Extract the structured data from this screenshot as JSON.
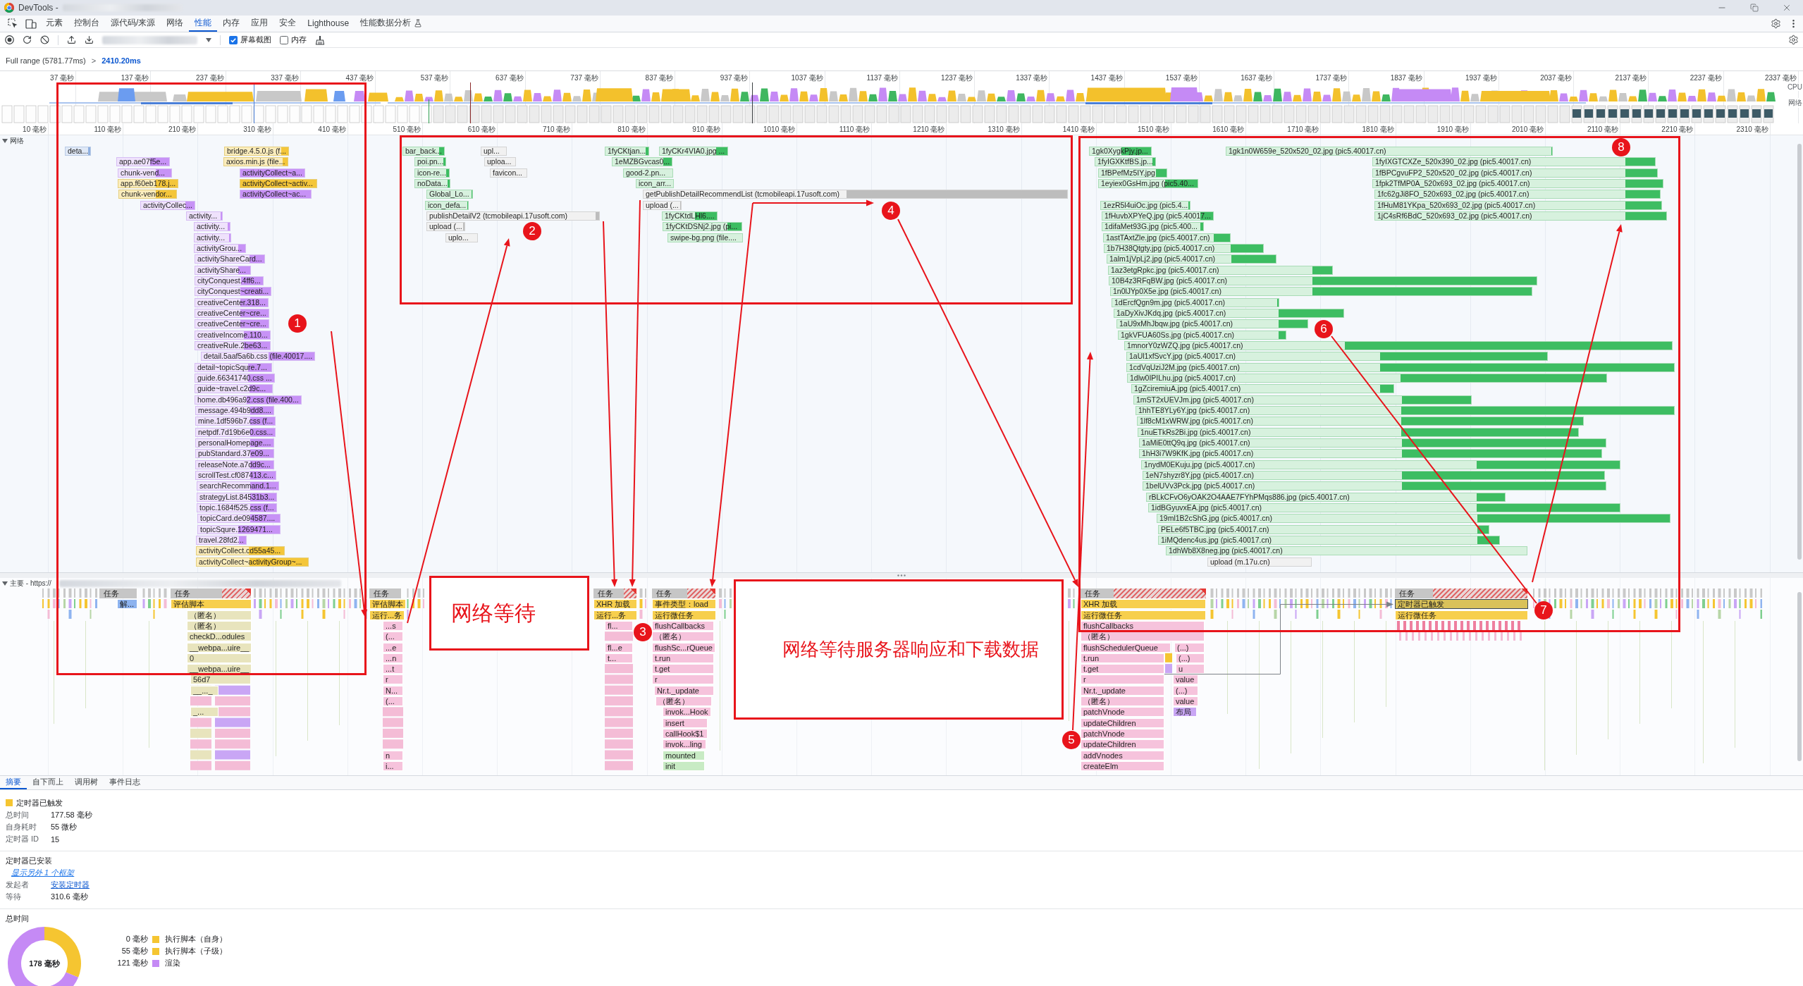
{
  "window": {
    "title": "DevTools -"
  },
  "tabs": [
    {
      "label": "元素",
      "selected": false
    },
    {
      "label": "控制台",
      "selected": false
    },
    {
      "label": "源代码/来源",
      "selected": false
    },
    {
      "label": "网络",
      "selected": false
    },
    {
      "label": "性能",
      "selected": true
    },
    {
      "label": "内存",
      "selected": false
    },
    {
      "label": "应用",
      "selected": false
    },
    {
      "label": "安全",
      "selected": false
    },
    {
      "label": "Lighthouse",
      "selected": false
    },
    {
      "label": "性能数据分析",
      "selected": false
    }
  ],
  "toolbar": {
    "options": [
      {
        "label": "屏幕截图",
        "checked": true
      },
      {
        "label": "内存",
        "checked": false
      }
    ]
  },
  "breadcrumb": {
    "full_range": "Full range (5781.77ms)",
    "separator": ">",
    "current": "2410.20ms"
  },
  "overview": {
    "ticks": [
      "37 毫秒",
      "137 毫秒",
      "237 毫秒",
      "337 毫秒",
      "437 毫秒",
      "537 毫秒",
      "637 毫秒",
      "737 毫秒",
      "837 毫秒",
      "937 毫秒",
      "1037 毫秒",
      "1137 毫秒",
      "1237 毫秒",
      "1337 毫秒",
      "1437 毫秒",
      "1537 毫秒",
      "1637 毫秒",
      "1737 毫秒",
      "1837 毫秒",
      "1937 毫秒",
      "2037 毫秒",
      "2137 毫秒",
      "2237 毫秒",
      "2337 毫秒"
    ],
    "track_labels": [
      "CPU",
      "网络"
    ]
  },
  "ruler": {
    "ticks": [
      "10 毫秒",
      "110 毫秒",
      "210 毫秒",
      "310 毫秒",
      "410 毫秒",
      "510 毫秒",
      "610 毫秒",
      "710 毫秒",
      "810 毫秒",
      "910 毫秒",
      "1010 毫秒",
      "1110 毫秒",
      "1210 毫秒",
      "1310 毫秒",
      "1410 毫秒",
      "1510 毫秒",
      "1610 毫秒",
      "1710 毫秒",
      "1810 毫秒",
      "1910 毫秒",
      "2010 毫秒",
      "2110 毫秒",
      "2210 毫秒",
      "2310 毫秒"
    ]
  },
  "network": {
    "title": "网络",
    "expanded": true,
    "requests": [
      {
        "label": "deta...",
        "kind": "document"
      },
      {
        "label": "bridge.4.5.0.js (f...",
        "kind": "script"
      },
      {
        "label": "app.ae07f5e...",
        "kind": "stylesheet"
      },
      {
        "label": "axios.min.js (file...",
        "kind": "script"
      },
      {
        "label": "chunk-vend...",
        "kind": "stylesheet"
      },
      {
        "label": "activityCollect~a...",
        "kind": "stylesheet"
      },
      {
        "label": "app.f60eb178.j...",
        "kind": "script"
      },
      {
        "label": "activityCollect~activ...",
        "kind": "script"
      },
      {
        "label": "chunk-vendor...",
        "kind": "script"
      },
      {
        "label": "activityCollect~ac...",
        "kind": "stylesheet"
      },
      {
        "label": "activityCollec...",
        "kind": "stylesheet"
      },
      {
        "label": "activity...",
        "kind": "stylesheet"
      },
      {
        "label": "activity...",
        "kind": "stylesheet"
      },
      {
        "label": "activity...",
        "kind": "stylesheet"
      },
      {
        "label": "activityGrou...",
        "kind": "stylesheet"
      },
      {
        "label": "activityShareCard...",
        "kind": "stylesheet"
      },
      {
        "label": "activityShare...",
        "kind": "stylesheet"
      },
      {
        "label": "cityConquest.4ff6...",
        "kind": "stylesheet"
      },
      {
        "label": "cityConquest~creati...",
        "kind": "stylesheet"
      },
      {
        "label": "creativeCenter.318...",
        "kind": "stylesheet"
      },
      {
        "label": "creativeCenter~cre...",
        "kind": "stylesheet"
      },
      {
        "label": "creativeCenter~cre...",
        "kind": "stylesheet"
      },
      {
        "label": "creativeIncome.110...",
        "kind": "stylesheet"
      },
      {
        "label": "creativeRule.2be63...",
        "kind": "stylesheet"
      },
      {
        "label": "detail.5aaf5a6b.css (file.40017....",
        "kind": "stylesheet"
      },
      {
        "label": "detail~topicSqure.7...",
        "kind": "stylesheet"
      },
      {
        "label": "guide.66341740.css ...",
        "kind": "stylesheet"
      },
      {
        "label": "guide~travel.c2d9c...",
        "kind": "stylesheet"
      },
      {
        "label": "home.db496a92.css (file.400...",
        "kind": "stylesheet"
      },
      {
        "label": "message.494b9dd8....",
        "kind": "stylesheet"
      },
      {
        "label": "mine.1df596b7.css (f...",
        "kind": "stylesheet"
      },
      {
        "label": "netpdf.7d19b6e0.css...",
        "kind": "stylesheet"
      },
      {
        "label": "personalHomepage....",
        "kind": "stylesheet"
      },
      {
        "label": "pubStandard.37e09...",
        "kind": "stylesheet"
      },
      {
        "label": "releaseNote.a7dd9c...",
        "kind": "stylesheet"
      },
      {
        "label": "scrollTest.cf087413.c...",
        "kind": "stylesheet"
      },
      {
        "label": "searchRecommand.1...",
        "kind": "stylesheet"
      },
      {
        "label": "strategyList.84531b3...",
        "kind": "stylesheet"
      },
      {
        "label": "topic.1684f525.css (f...",
        "kind": "stylesheet"
      },
      {
        "label": "topicCard.de094587....",
        "kind": "stylesheet"
      },
      {
        "label": "topicSqure.1269471...",
        "kind": "stylesheet"
      },
      {
        "label": "travel.28fd2...",
        "kind": "stylesheet"
      },
      {
        "label": "activityCollect.cd55a45...",
        "kind": "script"
      },
      {
        "label": "activityCollect~activityGroup~...",
        "kind": "script"
      },
      {
        "label": "bar_back...",
        "kind": "image"
      },
      {
        "label": "upl...",
        "kind": "other"
      },
      {
        "label": "poi.pn...",
        "kind": "image"
      },
      {
        "label": "uploa...",
        "kind": "other"
      },
      {
        "label": "icon-re...",
        "kind": "image"
      },
      {
        "label": "favicon...",
        "kind": "other"
      },
      {
        "label": "noData...",
        "kind": "image"
      },
      {
        "label": "Global_Lo...",
        "kind": "image"
      },
      {
        "label": "icon_defa...",
        "kind": "image"
      },
      {
        "label": "publishDetailV2 (tcmobileapi.17usoft.com)",
        "kind": "other"
      },
      {
        "label": "upload (...",
        "kind": "other"
      },
      {
        "label": "uplo...",
        "kind": "other"
      },
      {
        "label": "1fyCKtjan...",
        "kind": "image"
      },
      {
        "label": "1fyCKr4VIA0.jpg ...",
        "kind": "image"
      },
      {
        "label": "1eMZBGvcas0...",
        "kind": "image"
      },
      {
        "label": "good-2.pn...",
        "kind": "image"
      },
      {
        "label": "icon_arr...",
        "kind": "image"
      },
      {
        "label": "getPublishDetailRecommendList (tcmobileapi.17usoft.com)",
        "kind": "other"
      },
      {
        "label": "upload (...",
        "kind": "other"
      },
      {
        "label": "1fyCKtdLHl6....",
        "kind": "image"
      },
      {
        "label": "1fyCKtDSNj2.jpg (pi...",
        "kind": "image"
      },
      {
        "label": "swipe-bg.png (file....",
        "kind": "image"
      },
      {
        "label": "1gk0XygkPjy.jp...",
        "kind": "image"
      },
      {
        "label": "1gk1n0W659e_520x520_02.jpg (pic5.40017.cn)",
        "kind": "image"
      },
      {
        "label": "1fyIGXKtfBS.jp...",
        "kind": "image"
      },
      {
        "label": "1fyIXGTCXZe_520x390_02.jpg (pic5.40017.cn)",
        "kind": "image"
      },
      {
        "label": "1fBPefMz5IY.jpg",
        "kind": "image"
      },
      {
        "label": "1fBPCgvuFP2_520x520_02.jpg (pic5.40017.cn)",
        "kind": "image"
      },
      {
        "label": "1eyiex0GsHm.jpg (pic5.40...",
        "kind": "image"
      },
      {
        "label": "1fpk2TfMP0A_520x693_02.jpg (pic5.40017.cn)",
        "kind": "image"
      },
      {
        "label": "1fc62gJi8FO_520x693_02.jpg (pic5.40017.cn)",
        "kind": "image"
      },
      {
        "label": "1ezR5l4uiOc.jpg (pic5.4...",
        "kind": "image"
      },
      {
        "label": "1fHuM81YKpa_520x693_02.jpg (pic5.40017.cn)",
        "kind": "image"
      },
      {
        "label": "1fHuvbXPYeQ.jpg (pic5.40017...",
        "kind": "image"
      },
      {
        "label": "1jC4sRf6BdC_520x693_02.jpg (pic5.40017.cn)",
        "kind": "image"
      },
      {
        "label": "1difaMet93G.jpg (pic5.400...",
        "kind": "image"
      },
      {
        "label": "1astTAxtZle.jpg (pic5.40017.cn)",
        "kind": "image"
      },
      {
        "label": "1b7H38Qtgty.jpg (pic5.40017.cn)",
        "kind": "image"
      },
      {
        "label": "1alm1jVpLj2.jpg (pic5.40017.cn)",
        "kind": "image"
      },
      {
        "label": "1az3etgRpkc.jpg (pic5.40017.cn)",
        "kind": "image"
      },
      {
        "label": "10B4z3RFqBW.jpg (pic5.40017.cn)",
        "kind": "image"
      },
      {
        "label": "1n0lJYp0X5e.jpg (pic5.40017.cn)",
        "kind": "image"
      },
      {
        "label": "1dErcfQgn9m.jpg (pic5.40017.cn)",
        "kind": "image"
      },
      {
        "label": "1aDyXivJKdq.jpg (pic5.40017.cn)",
        "kind": "image"
      },
      {
        "label": "1aU9xMhJbqw.jpg (pic5.40017.cn)",
        "kind": "image"
      },
      {
        "label": "1gkVFUA60Ss.jpg (pic5.40017.cn)",
        "kind": "image"
      },
      {
        "label": "1mnorY0zWZQ.jpg (pic5.40017.cn)",
        "kind": "image"
      },
      {
        "label": "1aUl1xfSvcY.jpg (pic5.40017.cn)",
        "kind": "image"
      },
      {
        "label": "1cdVqUziJ2M.jpg (pic5.40017.cn)",
        "kind": "image"
      },
      {
        "label": "1dlw0IPILhu.jpg (pic5.40017.cn)",
        "kind": "image"
      },
      {
        "label": "1gZciremiuA.jpg (pic5.40017.cn)",
        "kind": "image"
      },
      {
        "label": "1mST2xUEVJm.jpg (pic5.40017.cn)",
        "kind": "image"
      },
      {
        "label": "1hhTE8YLy6Y.jpg (pic5.40017.cn)",
        "kind": "image"
      },
      {
        "label": "1lf8cM1xWRW.jpg (pic5.40017.cn)",
        "kind": "image"
      },
      {
        "label": "1nuETkRs2Bi.jpg (pic5.40017.cn)",
        "kind": "image"
      },
      {
        "label": "1aMiE0ttQ9q.jpg (pic5.40017.cn)",
        "kind": "image"
      },
      {
        "label": "1hH3i7W9KfK.jpg (pic5.40017.cn)",
        "kind": "image"
      },
      {
        "label": "1nydM0EKuju.jpg (pic5.40017.cn)",
        "kind": "image"
      },
      {
        "label": "1eN7shyzr8Y.jpg (pic5.40017.cn)",
        "kind": "image"
      },
      {
        "label": "1belUVv3Pck.jpg (pic5.40017.cn)",
        "kind": "image"
      },
      {
        "label": "rBLkCFvO6yOAK2O4AAE7FYhPMqs886.jpg (pic5.40017.cn)",
        "kind": "image"
      },
      {
        "label": "1idBGyuvxEA.jpg (pic5.40017.cn)",
        "kind": "image"
      },
      {
        "label": "19ml1B2cShG.jpg (pic5.40017.cn)",
        "kind": "image"
      },
      {
        "label": "PELe6f5TBC.jpg (pic5.40017.cn)",
        "kind": "image"
      },
      {
        "label": "1iMQdenc4us.jpg (pic5.40017.cn)",
        "kind": "image"
      },
      {
        "label": "1dhWb8X8neg.jpg (pic5.40017.cn)",
        "kind": "image"
      },
      {
        "label": "upload (m.17u.cn)",
        "kind": "other"
      }
    ]
  },
  "main": {
    "title": "主要 - https://",
    "expanded": true,
    "tasks": [
      {
        "label": "任务",
        "long": false
      },
      {
        "label": "任务",
        "long": true
      },
      {
        "label": "任务",
        "long": false
      },
      {
        "label": "任务",
        "long": true
      },
      {
        "label": "任务",
        "long": true
      },
      {
        "label": "任务",
        "long": true
      },
      {
        "label": "任务",
        "long": true
      }
    ],
    "frames": [
      {
        "label": "解...",
        "kind": "parse",
        "selected": false
      },
      {
        "label": "评估脚本",
        "kind": "event",
        "selected": false
      },
      {
        "label": "（匿名）",
        "kind": "module",
        "selected": false
      },
      {
        "label": "（匿名）",
        "kind": "module",
        "selected": false
      },
      {
        "label": "checkD...odules",
        "kind": "module",
        "selected": false
      },
      {
        "label": "__webpa...uire__",
        "kind": "module",
        "selected": false
      },
      {
        "label": "0",
        "kind": "module",
        "selected": false
      },
      {
        "label": "__webpa...uire__",
        "kind": "module",
        "selected": false
      },
      {
        "label": "56d7",
        "kind": "module",
        "selected": false
      },
      {
        "label": "__..._",
        "kind": "module",
        "selected": false
      },
      {
        "label": "_...",
        "kind": "module",
        "selected": false
      },
      {
        "label": "评估脚本",
        "kind": "event",
        "selected": false
      },
      {
        "label": "运行...务",
        "kind": "event",
        "selected": false
      },
      {
        "label": "...s",
        "kind": "function",
        "selected": false
      },
      {
        "label": "(...",
        "kind": "function",
        "selected": false
      },
      {
        "label": "...e",
        "kind": "function",
        "selected": false
      },
      {
        "label": "...n",
        "kind": "function",
        "selected": false
      },
      {
        "label": "...t",
        "kind": "function",
        "selected": false
      },
      {
        "label": "r",
        "kind": "function",
        "selected": false
      },
      {
        "label": "N...",
        "kind": "function",
        "selected": false
      },
      {
        "label": "(...",
        "kind": "function",
        "selected": false
      },
      {
        "label": "n",
        "kind": "function",
        "selected": false
      },
      {
        "label": "i...",
        "kind": "function",
        "selected": false
      },
      {
        "label": "XHR 加载",
        "kind": "event",
        "selected": false
      },
      {
        "label": "运行...务",
        "kind": "event",
        "selected": false
      },
      {
        "label": "fl...",
        "kind": "function",
        "selected": false
      },
      {
        "label": "fl...e",
        "kind": "function",
        "selected": false
      },
      {
        "label": "t...",
        "kind": "function",
        "selected": false
      },
      {
        "label": "事件类型：load",
        "kind": "event",
        "selected": false
      },
      {
        "label": "运行微任务",
        "kind": "event",
        "selected": false
      },
      {
        "label": "flushCallbacks",
        "kind": "function",
        "selected": false
      },
      {
        "label": "（匿名）",
        "kind": "function",
        "selected": false
      },
      {
        "label": "flushSc...rQueue",
        "kind": "function",
        "selected": false
      },
      {
        "label": "t.run",
        "kind": "function",
        "selected": false
      },
      {
        "label": "t.get",
        "kind": "function",
        "selected": false
      },
      {
        "label": "r",
        "kind": "function",
        "selected": false
      },
      {
        "label": "Nr.t._update",
        "kind": "function",
        "selected": false
      },
      {
        "label": "（匿名）",
        "kind": "function",
        "selected": false
      },
      {
        "label": "invok...Hook",
        "kind": "function",
        "selected": false
      },
      {
        "label": "insert",
        "kind": "function",
        "selected": false
      },
      {
        "label": "callHook$1",
        "kind": "function",
        "selected": false
      },
      {
        "label": "invok...ling",
        "kind": "function",
        "selected": false
      },
      {
        "label": "mounted",
        "kind": "hook",
        "selected": false
      },
      {
        "label": "init",
        "kind": "hook",
        "selected": false
      },
      {
        "label": "XHR 加载",
        "kind": "event",
        "selected": false
      },
      {
        "label": "运行微任务",
        "kind": "event",
        "selected": false
      },
      {
        "label": "flushCallbacks",
        "kind": "function",
        "selected": false
      },
      {
        "label": "（匿名）",
        "kind": "function",
        "selected": false
      },
      {
        "label": "flushSchedulerQueue",
        "kind": "function",
        "selected": false
      },
      {
        "label": "t.run",
        "kind": "function",
        "selected": false
      },
      {
        "label": "t.get",
        "kind": "function",
        "selected": false
      },
      {
        "label": "r",
        "kind": "function",
        "selected": false
      },
      {
        "label": "Nr.t._update",
        "kind": "function",
        "selected": false
      },
      {
        "label": "（匿名）",
        "kind": "function",
        "selected": false
      },
      {
        "label": "patchVnode",
        "kind": "function",
        "selected": false
      },
      {
        "label": "updateChildren",
        "kind": "function",
        "selected": false
      },
      {
        "label": "patchVnode",
        "kind": "function",
        "selected": false
      },
      {
        "label": "updateChildren",
        "kind": "function",
        "selected": false
      },
      {
        "label": "addVnodes",
        "kind": "function",
        "selected": false
      },
      {
        "label": "createElm",
        "kind": "function",
        "selected": false
      },
      {
        "label": "(...)",
        "kind": "function",
        "selected": false
      },
      {
        "label": "(...)",
        "kind": "function",
        "selected": false
      },
      {
        "label": "u",
        "kind": "function",
        "selected": false
      },
      {
        "label": "value",
        "kind": "function",
        "selected": false
      },
      {
        "label": "(...)",
        "kind": "function",
        "selected": false
      },
      {
        "label": "value",
        "kind": "function",
        "selected": false
      },
      {
        "label": "布局",
        "kind": "render",
        "selected": false
      },
      {
        "label": "定时器已触发",
        "kind": "event",
        "selected": true
      },
      {
        "label": "运行微任务",
        "kind": "event",
        "selected": false
      }
    ]
  },
  "annotations": {
    "markers": [
      "1",
      "2",
      "3",
      "4",
      "5",
      "6",
      "7",
      "8"
    ],
    "notes": [
      "网络等待",
      "网络等待服务器响应和下载数据"
    ]
  },
  "details": {
    "tabs": [
      {
        "label": "摘要",
        "selected": true
      },
      {
        "label": "自下而上",
        "selected": false
      },
      {
        "label": "调用树",
        "selected": false
      },
      {
        "label": "事件日志",
        "selected": false
      }
    ],
    "event": {
      "title": "定时器已触发",
      "color": "#f5c531",
      "rows": [
        {
          "label": "总时间",
          "value": "177.58 毫秒"
        },
        {
          "label": "自身耗时",
          "value": "55 微秒"
        },
        {
          "label": "定时器 ID",
          "value": "15"
        }
      ]
    },
    "installed": {
      "title": "定时器已安装",
      "stack_link": "显示另外 1 个框架",
      "rows": [
        {
          "label": "发起者",
          "value": "安装定时器",
          "kind": "link"
        },
        {
          "label": "等待",
          "value": "310.6 毫秒",
          "kind": "text"
        }
      ]
    },
    "total": {
      "title": "总时间",
      "center": "178 毫秒",
      "chart_data": {
        "type": "donut",
        "categories": [
          "执行脚本（自身）",
          "执行脚本（子级）",
          "渲染"
        ],
        "values": [
          0,
          31.2,
          68.8
        ]
      },
      "legend": [
        {
          "reading": "0 毫秒",
          "color": "#f5c531"
        },
        {
          "reading": "55 毫秒",
          "color": "#f5c531"
        },
        {
          "reading": "121 毫秒",
          "color": "#c58af5"
        }
      ]
    }
  }
}
